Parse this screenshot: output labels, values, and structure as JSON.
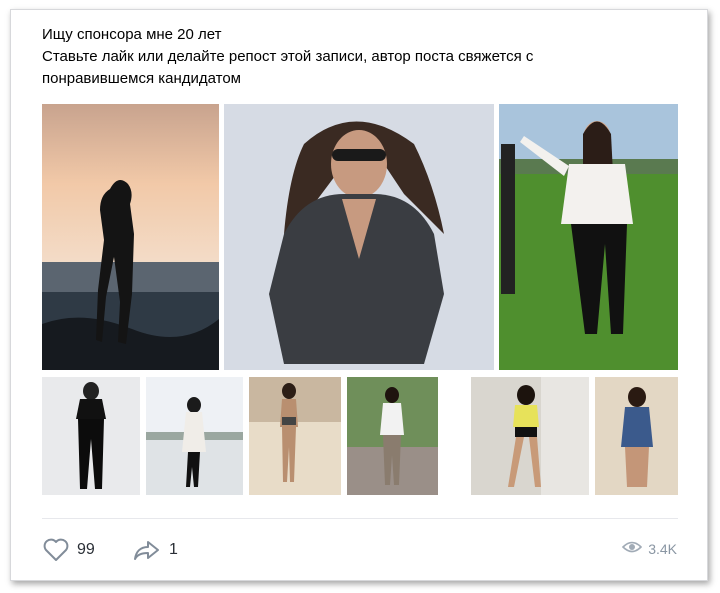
{
  "post": {
    "line1": "Ищу спонсора мне 20 лет",
    "line2": "Ставьте лайк или делайте репост этой записи, автор поста свяжется с",
    "line3": "понравившемся кандидатом"
  },
  "photos": [
    {
      "name": "photo-silhouette-sunset"
    },
    {
      "name": "photo-woman-sunglasses"
    },
    {
      "name": "photo-woman-field"
    },
    {
      "name": "photo-thumb-1"
    },
    {
      "name": "photo-thumb-2"
    },
    {
      "name": "photo-thumb-3"
    },
    {
      "name": "photo-thumb-4"
    },
    {
      "name": "photo-thumb-5"
    },
    {
      "name": "photo-thumb-6"
    }
  ],
  "actions": {
    "likes": "99",
    "shares": "1",
    "views": "3.4K"
  },
  "icons": {
    "like": "heart-icon",
    "share": "share-arrow-icon",
    "views": "eye-icon"
  }
}
